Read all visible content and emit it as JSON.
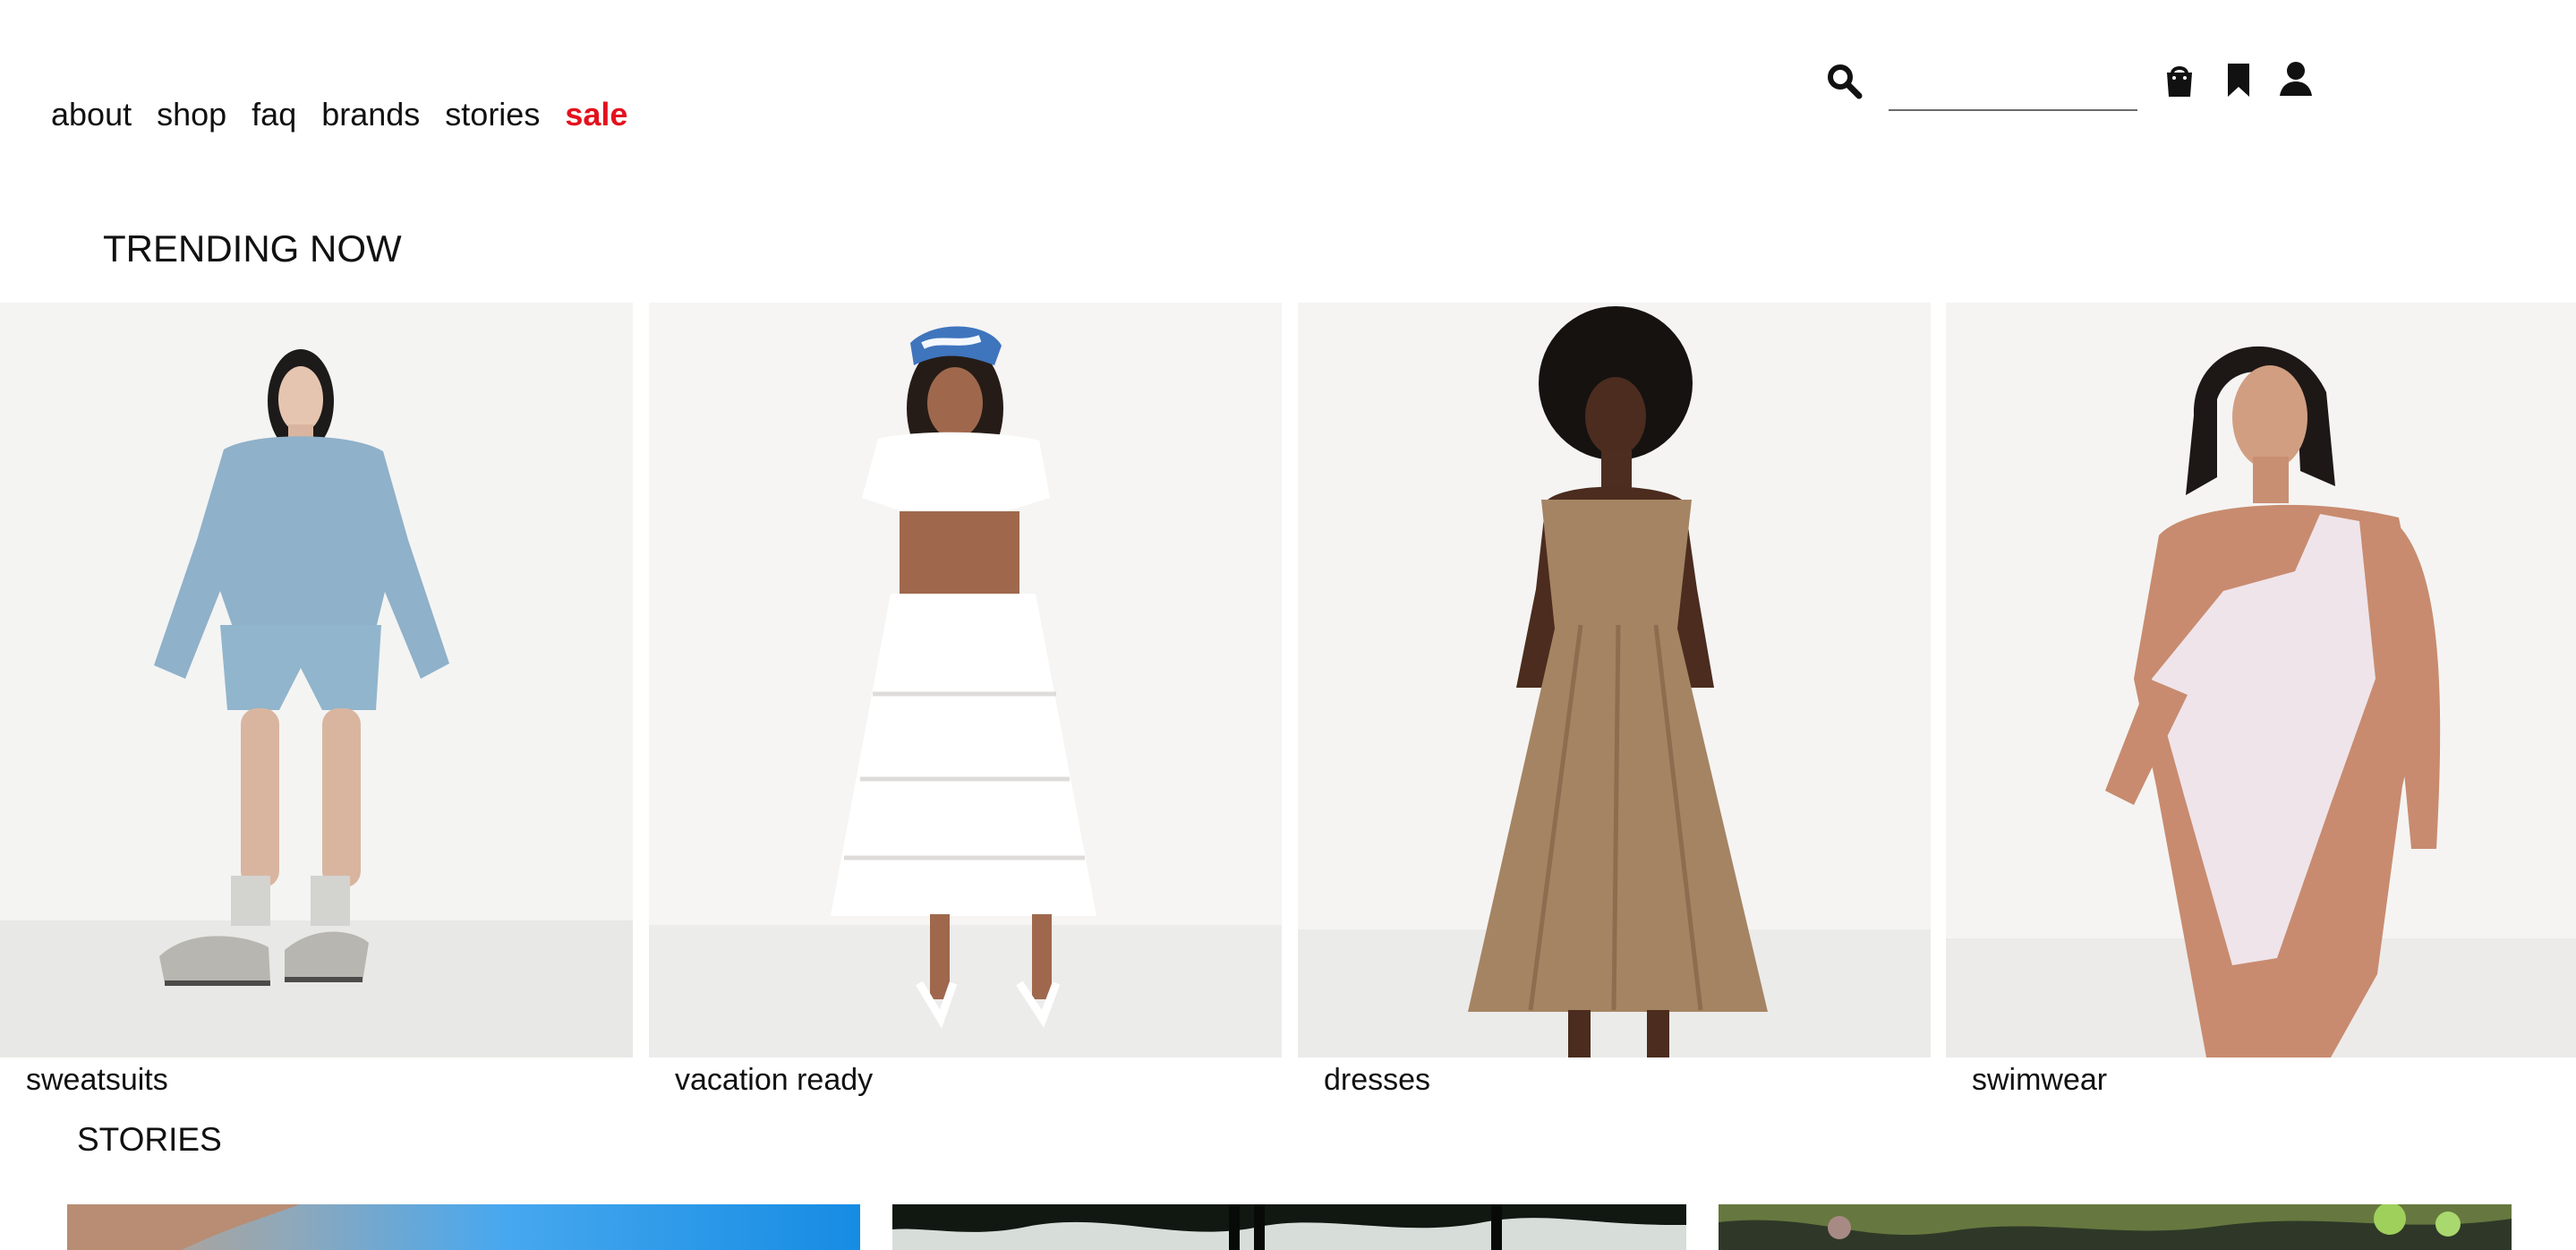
{
  "header": {
    "nav": [
      {
        "label": "about"
      },
      {
        "label": "shop"
      },
      {
        "label": "faq"
      },
      {
        "label": "brands"
      },
      {
        "label": "stories"
      },
      {
        "label": "sale",
        "accent": "#e3121d"
      }
    ],
    "search": {
      "value": "",
      "placeholder": ""
    },
    "icons": [
      "search-icon",
      "bag-icon",
      "bookmark-icon",
      "account-icon"
    ]
  },
  "trending": {
    "title": "TRENDING NOW",
    "cards": [
      {
        "label": "sweatsuits"
      },
      {
        "label": "vacation ready"
      },
      {
        "label": "dresses"
      },
      {
        "label": "swimwear"
      }
    ]
  },
  "stories": {
    "title": "STORIES",
    "items": [
      {
        "image": "story-image"
      },
      {
        "image": "story-image"
      },
      {
        "image": "story-image"
      }
    ]
  },
  "colors": {
    "text": "#111111",
    "sale": "#e3121d",
    "card_background": "#f3f3f2"
  }
}
